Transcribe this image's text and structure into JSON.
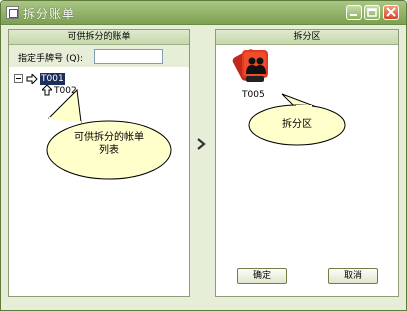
{
  "window": {
    "title": "拆分账单",
    "colors": {
      "titlebar": "#7da052",
      "panel_border": "#8e9d77",
      "selection": "#1c2e5b"
    }
  },
  "left_panel": {
    "header": "可供拆分的账单",
    "filter_label": "指定手牌号 (Q):",
    "filter_value": "",
    "tree": [
      {
        "label": "T001",
        "selected": true,
        "icon": "arrow-right-icon",
        "expanded": true
      },
      {
        "label": "T002",
        "selected": false,
        "icon": "arrow-up-icon"
      }
    ],
    "callout": [
      "可供拆分的帐单",
      "列表"
    ]
  },
  "transfer_arrow": {
    "icon": "chevron-right-icon"
  },
  "right_panel": {
    "header": "拆分区",
    "items": [
      {
        "label": "T005",
        "icon": "people-card-icon"
      }
    ],
    "callout": "拆分区",
    "confirm_label": "确定",
    "cancel_label": "取消"
  }
}
